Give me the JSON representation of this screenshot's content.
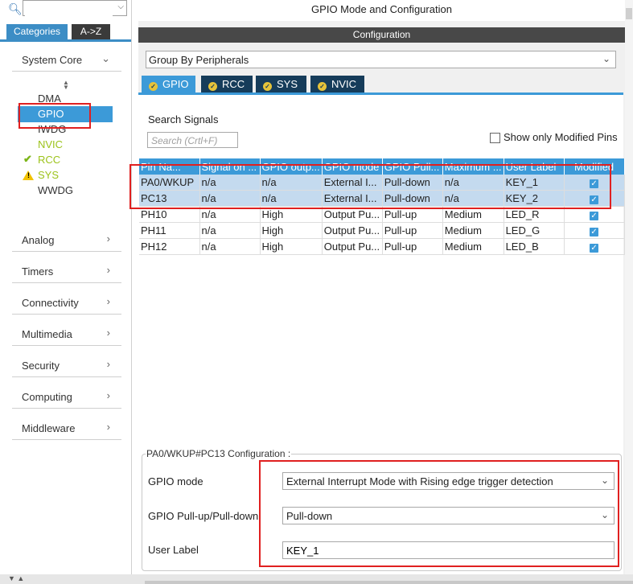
{
  "left": {
    "tabs": {
      "categories": "Categories",
      "az": "A->Z"
    },
    "categories": [
      {
        "label": "System Core",
        "top": 0
      },
      {
        "label": "Analog"
      },
      {
        "label": "Timers"
      },
      {
        "label": "Connectivity"
      },
      {
        "label": "Multimedia"
      },
      {
        "label": "Security"
      },
      {
        "label": "Computing"
      },
      {
        "label": "Middleware"
      }
    ],
    "system_core_items": [
      "DMA",
      "GPIO",
      "IWDG",
      "NVIC",
      "RCC",
      "SYS",
      "WWDG"
    ]
  },
  "header": {
    "title": "GPIO Mode and Configuration",
    "configuration": "Configuration"
  },
  "group_by": "Group By Peripherals",
  "peripheral_tabs": [
    "GPIO",
    "RCC",
    "SYS",
    "NVIC"
  ],
  "search": {
    "label": "Search Signals",
    "placeholder": "Search (Crtl+F)",
    "show_modified": "Show only Modified Pins"
  },
  "table": {
    "columns": [
      "Pin Na...",
      "Signal on ...",
      "GPIO outp...",
      "GPIO mode",
      "GPIO Pull...",
      "Maximum ...",
      "User Label",
      "Modified"
    ],
    "rows": [
      [
        "PA0/WKUP",
        "n/a",
        "n/a",
        "External I...",
        "Pull-down",
        "n/a",
        "KEY_1"
      ],
      [
        "PC13",
        "n/a",
        "n/a",
        "External I...",
        "Pull-down",
        "n/a",
        "KEY_2"
      ],
      [
        "PH10",
        "n/a",
        "High",
        "Output Pu...",
        "Pull-up",
        "Medium",
        "LED_R"
      ],
      [
        "PH11",
        "n/a",
        "High",
        "Output Pu...",
        "Pull-up",
        "Medium",
        "LED_G"
      ],
      [
        "PH12",
        "n/a",
        "High",
        "Output Pu...",
        "Pull-up",
        "Medium",
        "LED_B"
      ]
    ]
  },
  "config": {
    "title": "PA0/WKUP#PC13 Configuration :",
    "gpio_mode_label": "GPIO mode",
    "gpio_mode_value": "External Interrupt Mode with Rising edge trigger detection",
    "pull_label": "GPIO Pull-up/Pull-down",
    "pull_value": "Pull-down",
    "user_label_label": "User Label",
    "user_label_value": "KEY_1"
  },
  "colors": {
    "accent": "#3c9ad8",
    "dark_tab": "#163c5a",
    "highlight": "#e02020"
  }
}
